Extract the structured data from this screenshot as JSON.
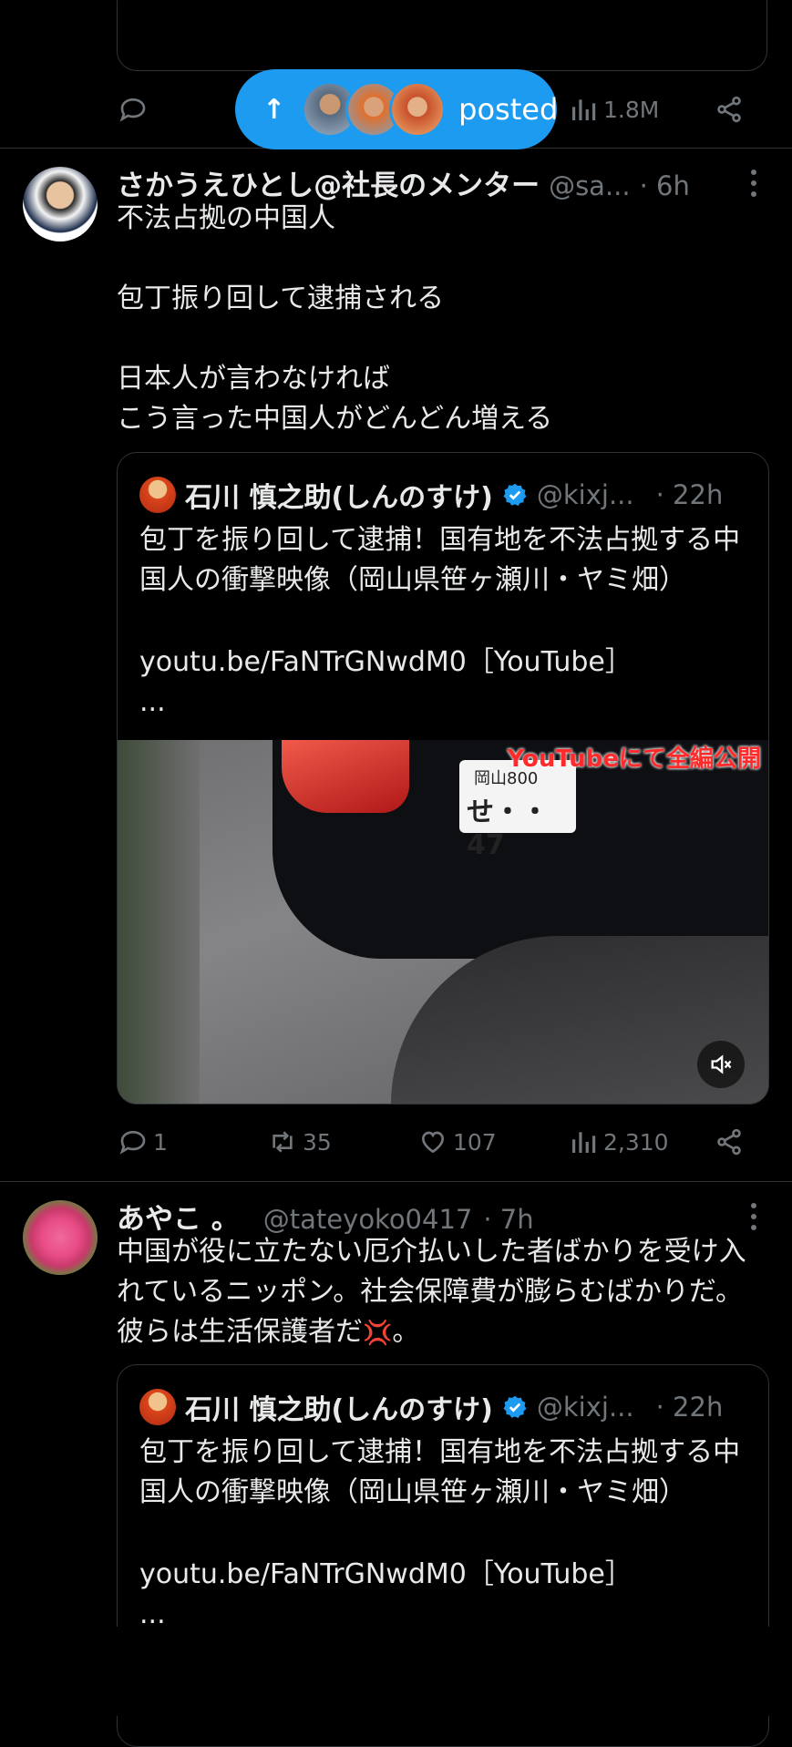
{
  "prev_tweet": {
    "views": "1.8M"
  },
  "pill": {
    "label": "posted"
  },
  "tweet1": {
    "author_name": "さかうえひとし@社長のメンター",
    "handle": "@sa...",
    "time": "· 6h",
    "text": "不法占拠の中国人\n\n包丁振り回して逮捕される\n\n日本人が言わなければ\nこう言った中国人がどんどん増える",
    "quote": {
      "author_name": "石川 慎之助(しんのすけ)",
      "handle": "@kixj...",
      "time": "· 22h",
      "text": "包丁を振り回して逮捕！国有地を不法占拠する中国人の衝撃映像（岡山県笹ヶ瀬川・ヤミ畑）",
      "link": "youtu.be/FaNTrGNwdM0［YouTube］",
      "ellipsis": "...",
      "media_banner": "YouTubeにて全編公開",
      "plate_top": "岡山800",
      "plate_bottom": "せ・・47"
    },
    "stats": {
      "replies": "1",
      "reposts": "35",
      "likes": "107",
      "views": "2,310"
    }
  },
  "tweet2": {
    "author_name": "あやこ 。",
    "handle": "@tateyoko0417",
    "time": "· 7h",
    "text": "中国が役に立たない厄介払いした者ばかりを受け入れているニッポン。社会保障費が膨らむばかりだ。彼らは生活保護者だ",
    "text_end": "。",
    "quote": {
      "author_name": "石川 慎之助(しんのすけ)",
      "handle": "@kixj...",
      "time": "· 22h",
      "text": "包丁を振り回して逮捕！国有地を不法占拠する中国人の衝撃映像（岡山県笹ヶ瀬川・ヤミ畑）",
      "link": "youtu.be/FaNTrGNwdM0［YouTube］",
      "ellipsis": "..."
    }
  },
  "colors": {
    "accent": "#1d9bf0",
    "background": "#000000",
    "muted": "#71767b",
    "divider": "#2f3336"
  }
}
